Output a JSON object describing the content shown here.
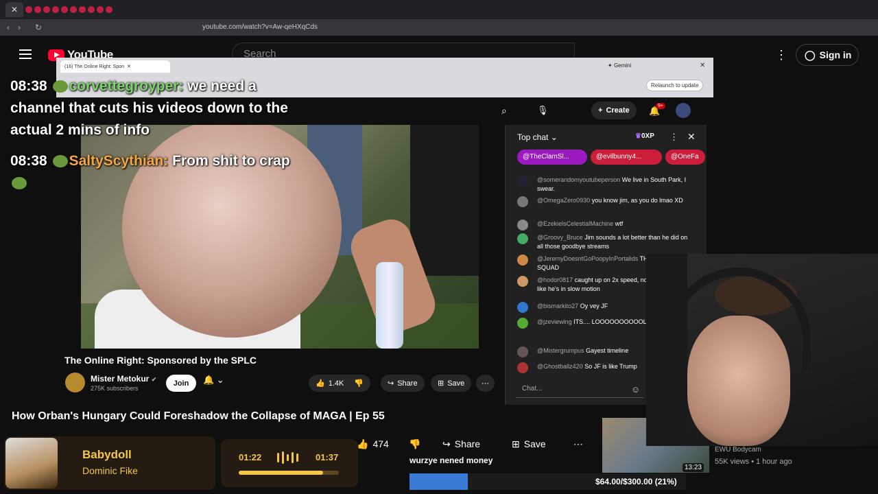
{
  "browser": {
    "url": "youtube.com/watch?v=Aw-qeHXqCds"
  },
  "youtube": {
    "logo": "YouTube",
    "search_placeholder": "Search",
    "signin": "Sign in"
  },
  "overlay_browser": {
    "tab_title": "(16) The Online Right: Spon",
    "gemini": "Gemini",
    "relaunch": "Relaunch to update",
    "create": "Create",
    "notif_count": "9+"
  },
  "overlay_chat": [
    {
      "time": "08:38",
      "user": "corvettegroyper:",
      "text": "we need a channel that cuts his videos down to the actual 2 mins of info"
    },
    {
      "time": "08:38",
      "user": "SaltyScythian:",
      "text": "From shit to crap"
    }
  ],
  "live_chat": {
    "header": "Top chat",
    "xp": "0XP",
    "pinned": [
      "@TheClamSl...",
      "@evilbunny4...",
      "@OneFa"
    ],
    "messages": [
      {
        "user": "@somerandomyoutubeperson",
        "text": "We live in South Park, I swear."
      },
      {
        "user": "@OmegaZero0930",
        "text": "you know jim, as you do lmao XD"
      },
      {
        "user": "@EzekielsCelestialMachine",
        "text": "wtf"
      },
      {
        "user": "@Groovy_Bruce",
        "text": "Jim sounds a lot better than he did on all those goodbye streams"
      },
      {
        "user": "@JeremyDoesntGoPoopyInPortalids",
        "text": "THE SASSY SQUAD"
      },
      {
        "user": "@hodor0817",
        "text": "caught up on 2x speed, now Jim sounds like he's in slow motion"
      },
      {
        "user": "@bismarkito27",
        "text": "Oy vey JF"
      },
      {
        "user": "@jzeviewing",
        "text": "ITS.... LOOOOOOOOOOL"
      },
      {
        "user": "@Mistergrumpus",
        "text": "Gayest timeline"
      },
      {
        "user": "@Ghostballz420",
        "text": "So JF is like Trump"
      }
    ],
    "input_placeholder": "Chat..."
  },
  "video": {
    "title": "The Online Right: Sponsored by the SPLC",
    "channel": "Mister Metokur",
    "subscribers": "275K subscribers",
    "join": "Join",
    "likes": "1.4K",
    "share": "Share",
    "save": "Save"
  },
  "main_video": {
    "title": "How Orban's Hungary Could Foreshadow the Collapse of MAGA | Ep 55",
    "likes": "474",
    "share": "Share",
    "save": "Save"
  },
  "now_playing": {
    "song": "Babydoll",
    "artist": "Dominic Fike",
    "elapsed": "01:22",
    "total": "01:37",
    "progress": 0.84
  },
  "donation": {
    "text": "wurzye nened money",
    "goal": "$64.00/$300.00 (21%)",
    "fraction": 0.21
  },
  "sidebar_video": {
    "duration": "13:23",
    "channel": "EWU Bodycam",
    "meta": "55K views • 1 hour ago"
  },
  "colors": {
    "accent": "#ff0033",
    "overlay_gold": "#f5c64a",
    "goal_blue": "#3a7bd5"
  }
}
